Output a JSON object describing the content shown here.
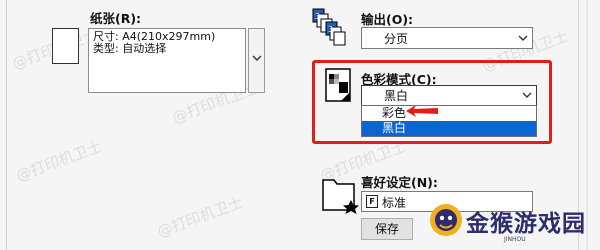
{
  "paper": {
    "label": "纸张(R):",
    "size_line": "尺寸: A4(210x297mm)",
    "type_line": "类型: 自动选择"
  },
  "output": {
    "label": "输出(O):",
    "selected": "分页"
  },
  "color_mode": {
    "label": "色彩模式(C):",
    "selected": "黑白",
    "options": [
      "彩色",
      "黑白"
    ],
    "highlighted_option": "黑白",
    "accent_color": "#0a64d2",
    "annotation_color": "#e21b1b"
  },
  "favorites": {
    "label": "喜好设定(N):",
    "selected": "标准",
    "save_button": "保存"
  },
  "watermark": "@打印机卫士",
  "logo": {
    "text": "金猴游戏园",
    "sub": "JINHOU"
  }
}
